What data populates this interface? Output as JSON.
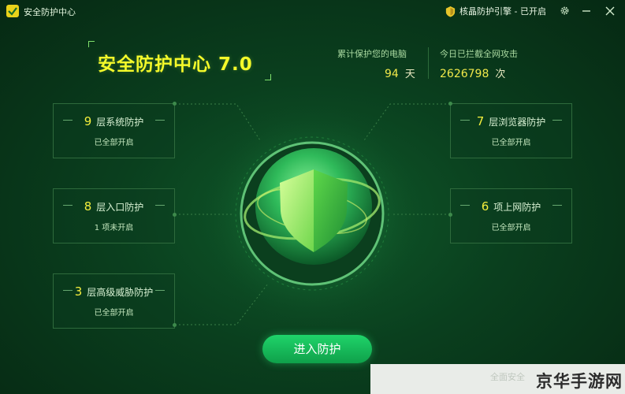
{
  "window": {
    "title": "安全防护中心",
    "engine_badge": "核晶防护引擎 - 已开启",
    "controls": [
      "settings-icon",
      "minimize-icon",
      "close-icon"
    ]
  },
  "header": {
    "headline": "安全防护中心 7.0"
  },
  "stats": {
    "protect_days": {
      "label": "累计保护您的电脑",
      "value": "94",
      "unit": "天"
    },
    "blocked_attacks": {
      "label": "今日已拦截全网攻击",
      "value": "2626798",
      "unit": "次"
    }
  },
  "cards": {
    "system": {
      "num": "9",
      "label": "层系统防护",
      "status": "已全部开启"
    },
    "entry": {
      "num": "8",
      "label": "层入口防护",
      "status": "1 项未开启"
    },
    "threat": {
      "num": "3",
      "label": "层高级威胁防护",
      "status": "已全部开启"
    },
    "browser": {
      "num": "7",
      "label": "层浏览器防护",
      "status": "已全部开启"
    },
    "online": {
      "num": "6",
      "label": "项上网防护",
      "status": "已全部开启"
    }
  },
  "actions": {
    "enter_label": "进入防护"
  },
  "watermark": {
    "faint_text": "全面安全",
    "text": "京华手游网"
  },
  "colors": {
    "accent_yellow": "#f4ee3c",
    "button_green": "#1fd46a",
    "background_dark": "#062913"
  }
}
